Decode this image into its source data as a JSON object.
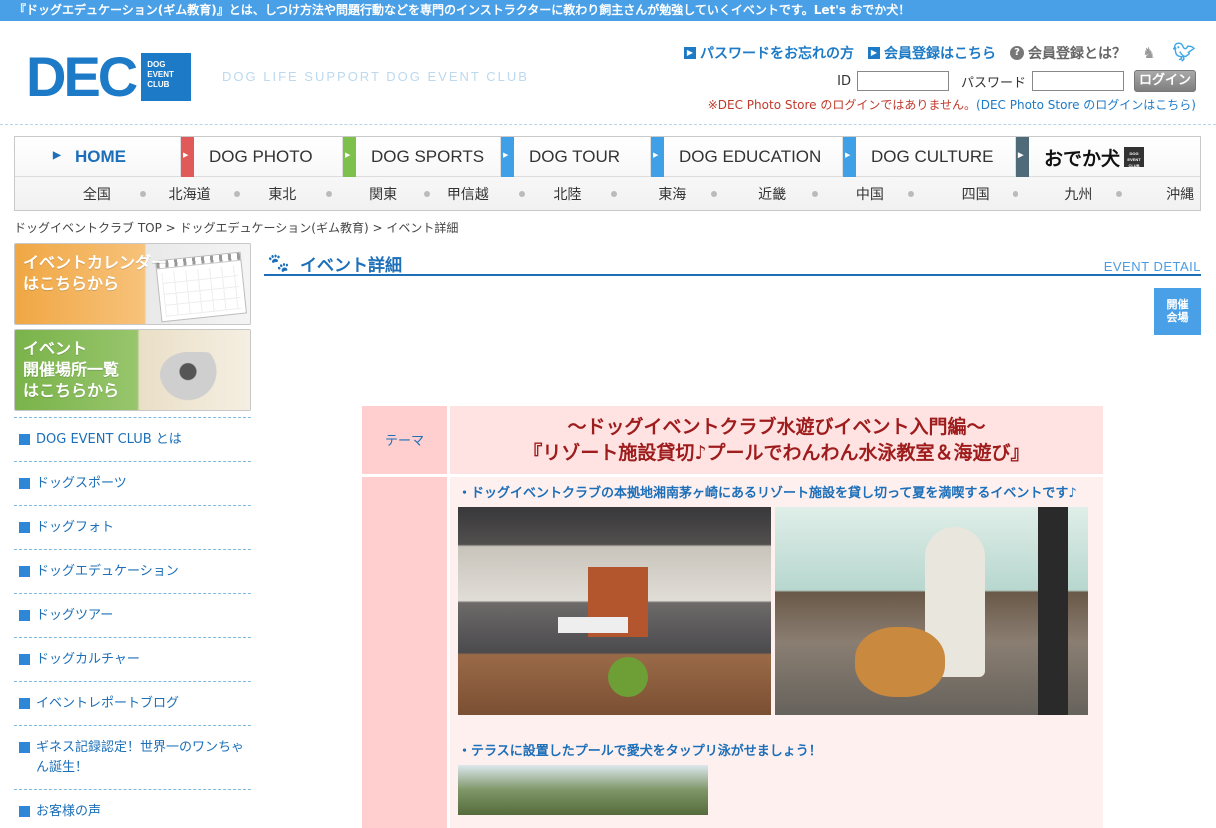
{
  "topbar": {
    "text": "『ドッグエデュケーション(ギム教育)』とは、しつけ方法や問題行動などを専門のインストラクターに教わり飼主さんが勉強していくイベントです。Let's おでか犬！"
  },
  "logo": {
    "main": "DEC",
    "box": "DOG EVENT CLUB",
    "tagline": "DOG LIFE SUPPORT DOG EVENT CLUB"
  },
  "header_links": {
    "forgot": "パスワードをお忘れの方",
    "register": "会員登録はこちら",
    "what": "会員登録とは？"
  },
  "login": {
    "id_label": "ID",
    "pw_label": "パスワード",
    "button": "ログイン",
    "note": "※DEC Photo Store のログインではありません。",
    "note_link": "(DEC Photo Store のログインはこちら)"
  },
  "nav": {
    "main": [
      {
        "label": "HOME",
        "color": "#1c6fb8"
      },
      {
        "label": "DOG PHOTO",
        "color": "#e05a5a"
      },
      {
        "label": "DOG SPORTS",
        "color": "#7dc04c"
      },
      {
        "label": "DOG TOUR",
        "color": "#3fa0e8"
      },
      {
        "label": "DOG EDUCATION",
        "color": "#3fa0e8"
      },
      {
        "label": "DOG CULTURE",
        "color": "#3fa0e8"
      },
      {
        "label": "おでか犬",
        "color": "#4f6b7a"
      }
    ],
    "brand_tag": "DOG EVENT CLUB",
    "regions": [
      "全国",
      "北海道",
      "東北",
      "関東",
      "甲信越",
      "北陸",
      "東海",
      "近畿",
      "中国",
      "四国",
      "九州",
      "沖縄"
    ]
  },
  "breadcrumb": "ドッグイベントクラブ TOP > ドッグエデュケーション(ギム教育) > イベント詳細",
  "banners": {
    "calendar": "イベントカレンダー\nはこちらから",
    "venues": "イベント\n開催場所一覧\nはこちらから"
  },
  "side_menu": [
    "DOG EVENT CLUB とは",
    "ドッグスポーツ",
    "ドッグフォト",
    "ドッグエデュケーション",
    "ドッグツアー",
    "ドッグカルチャー",
    "イベントレポートブログ",
    "ギネス記録認定！世界一のワンちゃん誕生！",
    "お客様の声"
  ],
  "main": {
    "title": "イベント詳細",
    "title_en": "EVENT DETAIL",
    "venue_button": "開催\n会場"
  },
  "event": {
    "theme_label": "テーマ",
    "title_line1": "～ドッグイベントクラブ水遊びイベント入門編～",
    "title_line2": "『リゾート施設貸切♪プールでわんわん水泳教室＆海遊び』",
    "bullet1": "・ドッグイベントクラブの本拠地湘南茅ヶ崎にあるリゾート施設を貸し切って夏を満喫するイベントです♪",
    "bullet2": "・テラスに設置したプールで愛犬をタップリ泳がせましょう！"
  }
}
